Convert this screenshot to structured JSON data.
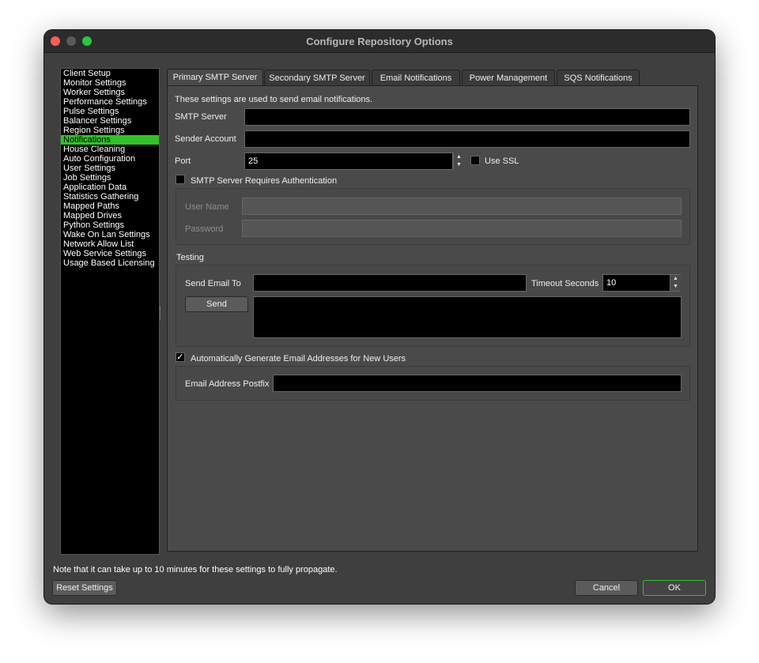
{
  "window": {
    "title": "Configure Repository Options"
  },
  "sidebar": {
    "items": [
      {
        "label": "Client Setup",
        "active": false
      },
      {
        "label": "Monitor Settings",
        "active": false
      },
      {
        "label": "Worker Settings",
        "active": false
      },
      {
        "label": "Performance Settings",
        "active": false
      },
      {
        "label": "Pulse Settings",
        "active": false
      },
      {
        "label": "Balancer Settings",
        "active": false
      },
      {
        "label": "Region Settings",
        "active": false
      },
      {
        "label": "Notifications",
        "active": true
      },
      {
        "label": "House Cleaning",
        "active": false
      },
      {
        "label": "Auto Configuration",
        "active": false
      },
      {
        "label": "User Settings",
        "active": false
      },
      {
        "label": "Job Settings",
        "active": false
      },
      {
        "label": "Application Data",
        "active": false
      },
      {
        "label": "Statistics Gathering",
        "active": false
      },
      {
        "label": "Mapped Paths",
        "active": false
      },
      {
        "label": "Mapped Drives",
        "active": false
      },
      {
        "label": "Python Settings",
        "active": false
      },
      {
        "label": "Wake On Lan Settings",
        "active": false
      },
      {
        "label": "Network Allow List",
        "active": false
      },
      {
        "label": "Web Service Settings",
        "active": false
      },
      {
        "label": "Usage Based Licensing",
        "active": false
      }
    ]
  },
  "tabs": [
    {
      "label": "Primary SMTP Server",
      "active": true
    },
    {
      "label": "Secondary SMTP Server",
      "active": false
    },
    {
      "label": "Email Notifications",
      "active": false
    },
    {
      "label": "Power Management",
      "active": false
    },
    {
      "label": "SQS Notifications",
      "active": false
    }
  ],
  "smtp": {
    "description": "These settings are used to send email notifications.",
    "server_label": "SMTP Server",
    "server_value": "",
    "sender_label": "Sender Account",
    "sender_value": "",
    "port_label": "Port",
    "port_value": "25",
    "use_ssl_label": "Use SSL",
    "use_ssl": false,
    "auth_label": "SMTP Server Requires Authentication",
    "auth_required": false,
    "username_label": "User Name",
    "username_value": "",
    "password_label": "Password",
    "password_value": ""
  },
  "testing": {
    "section_label": "Testing",
    "send_to_label": "Send Email To",
    "send_to_value": "",
    "timeout_label": "Timeout Seconds",
    "timeout_value": "10",
    "send_button": "Send",
    "output": ""
  },
  "auto_email": {
    "label": "Automatically Generate Email Addresses for New Users",
    "checked": true,
    "check_glyph": "✓",
    "postfix_label": "Email Address Postfix",
    "postfix_value": ""
  },
  "footer": {
    "note": "Note that it can take up to 10 minutes for these settings to fully propagate.",
    "reset_button": "Reset Settings",
    "cancel_button": "Cancel",
    "ok_button": "OK"
  },
  "colors": {
    "accent": "#2fc325",
    "window_bg": "#3f3f3f",
    "panel_bg": "#4a4a4a",
    "field_bg": "#000000"
  },
  "icons": {
    "close": "close-icon",
    "minimize": "minimize-icon",
    "maximize": "maximize-icon",
    "spinner": "spinner-arrows-icon",
    "checkmark": "checkmark-icon"
  }
}
